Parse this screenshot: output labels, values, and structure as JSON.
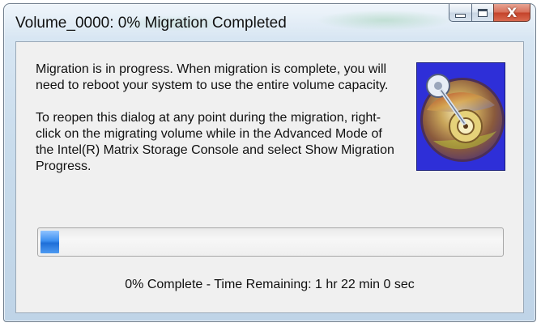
{
  "window": {
    "title": "Volume_0000: 0% Migration Completed",
    "caption_buttons": {
      "minimize_icon": "minimize-icon",
      "maximize_icon": "maximize-icon",
      "close_glyph": "X"
    }
  },
  "message": {
    "paragraph_1": "Migration is in progress. When migration is complete, you will need to reboot your system to use the entire volume capacity.",
    "paragraph_2": "To reopen this dialog at any point during the migration, right-click on the migrating volume while in the Advanced Mode of the Intel(R) Matrix Storage Console and select Show Migration Progress."
  },
  "illustration": {
    "icon": "hard-disk-icon"
  },
  "progress": {
    "value_fraction": 0.04,
    "status_text": "0% Complete - Time Remaining: 1 hr 22 min 0 sec"
  },
  "colors": {
    "progress_fill": "#3c8ff0",
    "close_button": "#c4432a",
    "illustration_background": "#2e2fd8"
  }
}
